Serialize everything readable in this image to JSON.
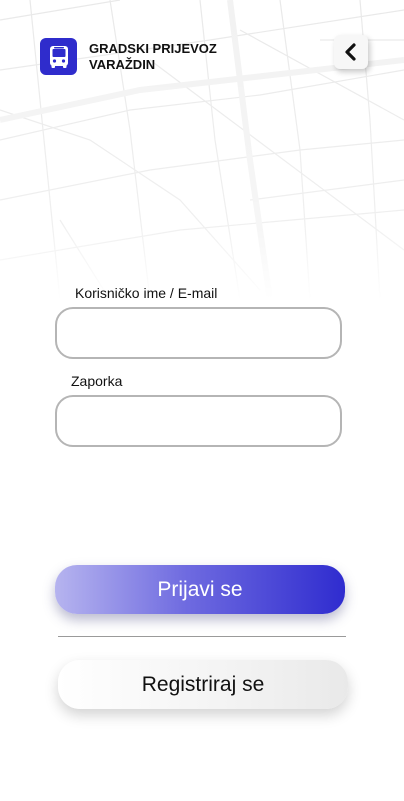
{
  "header": {
    "app_name_line1": "GRADSKI PRIJEVOZ",
    "app_name_line2": "VARAŽDIN",
    "logo_icon": "bus-icon",
    "back_icon": "chevron-left-icon"
  },
  "form": {
    "username_label": "Korisničko ime / E-mail",
    "username_value": "",
    "password_label": "Zaporka",
    "password_value": ""
  },
  "actions": {
    "login_label": "Prijavi se",
    "register_label": "Registriraj se"
  },
  "colors": {
    "brand": "#2f2ccc",
    "login_gradient_start": "#b6b4ef",
    "login_gradient_end": "#2f2ccf",
    "field_border": "#b5b5b5",
    "map_lines": "#ececec"
  }
}
